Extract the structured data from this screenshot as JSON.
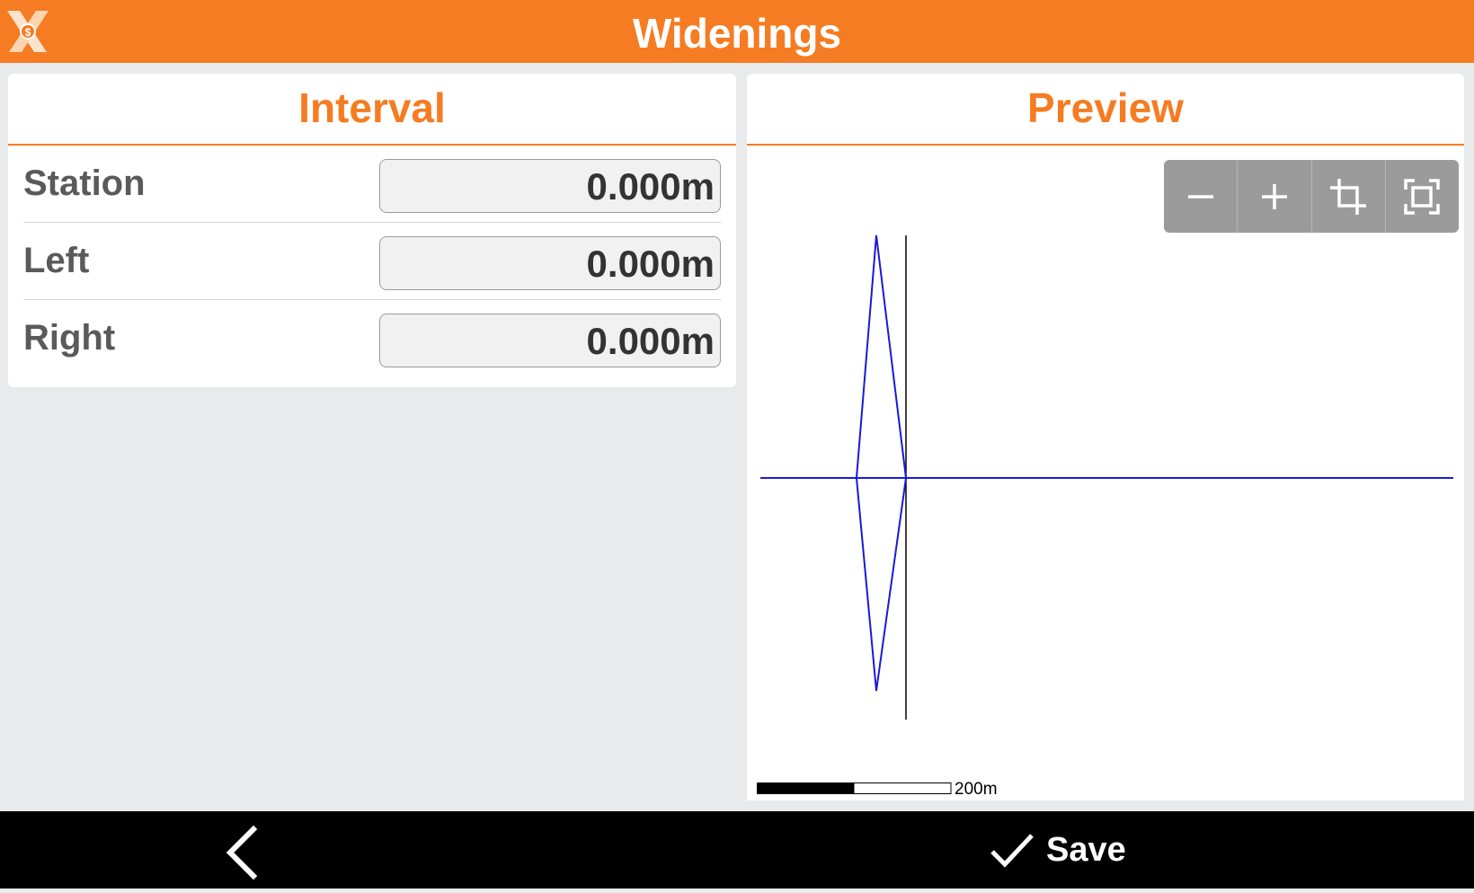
{
  "header": {
    "title": "Widenings",
    "logo_icon": "app-logo-icon"
  },
  "interval": {
    "title": "Interval",
    "fields": [
      {
        "label": "Station",
        "value": "0.000m"
      },
      {
        "label": "Left",
        "value": "0.000m"
      },
      {
        "label": "Right",
        "value": "0.000m"
      }
    ]
  },
  "preview": {
    "title": "Preview",
    "toolbar": [
      "zoom-out-icon",
      "zoom-in-icon",
      "crop-icon",
      "fit-extent-icon"
    ],
    "scale_label": "200m",
    "colors": {
      "alignment": "#1a1ad6",
      "axis": "#000000"
    }
  },
  "footer": {
    "back_icon": "chevron-left-icon",
    "save_icon": "checkmark-icon",
    "save_label": "Save"
  },
  "colors": {
    "accent": "#f57c22",
    "background": "#e9eaec"
  }
}
